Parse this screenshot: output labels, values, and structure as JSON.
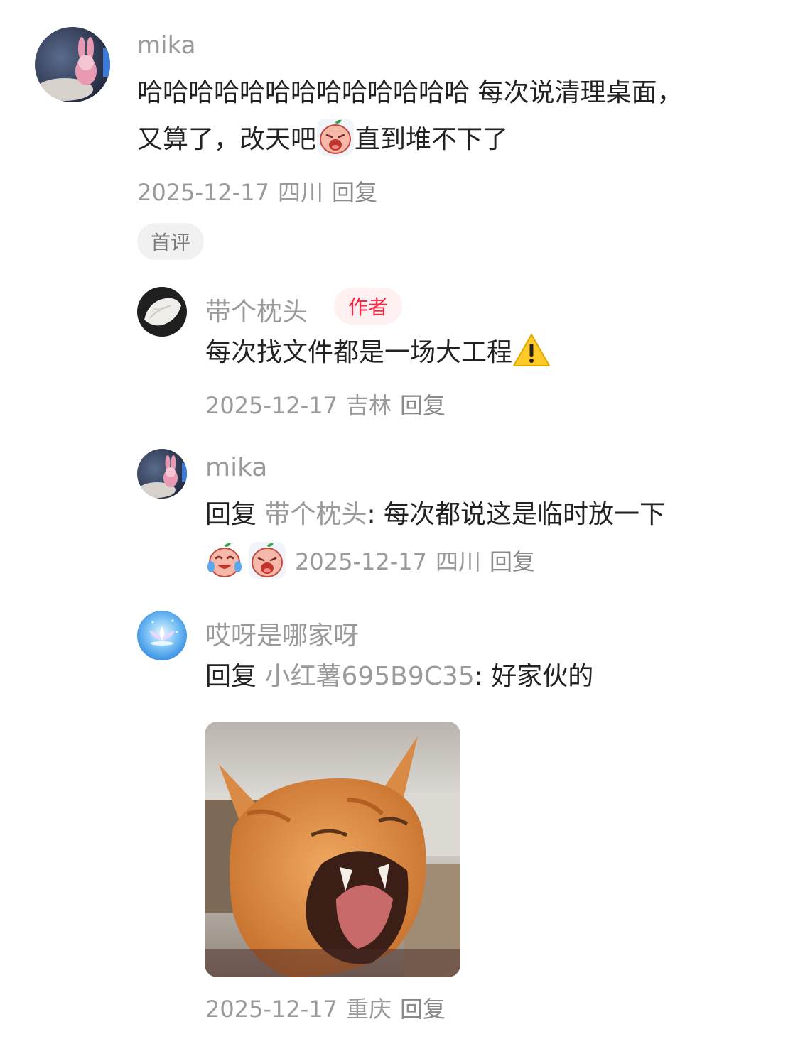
{
  "comments": {
    "c1": {
      "name": "mika",
      "line1": "哈哈哈哈哈哈哈哈哈哈哈哈哈 每次说清理桌面，",
      "line2_a": "又算了，改天吧",
      "line2_b": "直到堆不下了",
      "date": "2025-12-17",
      "location": "四川",
      "reply_label": "回复",
      "badge": "首评"
    },
    "r1": {
      "name": "带个枕头",
      "tag": "作者",
      "text": "每次找文件都是一场大工程",
      "date": "2025-12-17",
      "location": "吉林",
      "reply_label": "回复"
    },
    "r2": {
      "name": "mika",
      "reply_prefix": "回复",
      "reply_to": "带个枕头",
      "text": ": 每次都说这是临时放一下",
      "date": "2025-12-17",
      "location": "四川",
      "reply_label": "回复"
    },
    "r3": {
      "name": "哎呀是哪家呀",
      "reply_prefix": "回复",
      "reply_to": "小红薯695B9C35",
      "text": ": 好家伙的",
      "date": "2025-12-17",
      "location": "重庆",
      "reply_label": "回复"
    }
  },
  "icons": {
    "emoji_1": "crying-peach-emoji-icon",
    "emoji_2": "laughing-tears-peach-emoji-icon",
    "warning": "warning-icon",
    "image": "screaming-orange-cat-photo"
  },
  "colors": {
    "author_tag_text": "#ff2442",
    "author_tag_bg": "#fff0f2",
    "muted_text": "#9a9a9a",
    "body_text": "#222222"
  }
}
